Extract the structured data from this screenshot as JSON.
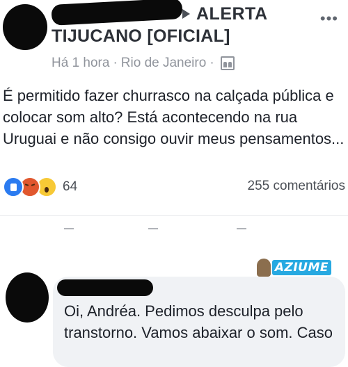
{
  "post": {
    "group_name_line1": "ALERTA",
    "group_name_line2": "TIJUCANO [OFICIAL]",
    "more_icon": "more-dots-icon",
    "time": "Há 1 hora",
    "separator": "·",
    "location": "Rio de Janeiro",
    "audience_icon": "group-icon",
    "text": "É permitido fazer churrasco na calçada pública e colocar som alto? Está acontecendo na rua Uruguai e não consigo ouvir meus pensamentos...",
    "reactions": {
      "icons": [
        "like-icon",
        "angry-icon",
        "wow-icon"
      ],
      "count": "64"
    },
    "comments_count": "255 comentários"
  },
  "watermark": {
    "text": "AZIUME"
  },
  "comment": {
    "text": "Oi, Andréa. Pedimos desculpa pelo transtorno. Vamos abaixar o som. Caso"
  },
  "colors": {
    "like": "#2b7bf0",
    "angry": "#e0572e",
    "wow": "#f7c936",
    "meta_text": "#90949c",
    "comment_bubble": "#f0f2f5",
    "watermark": "#27a9e1"
  }
}
